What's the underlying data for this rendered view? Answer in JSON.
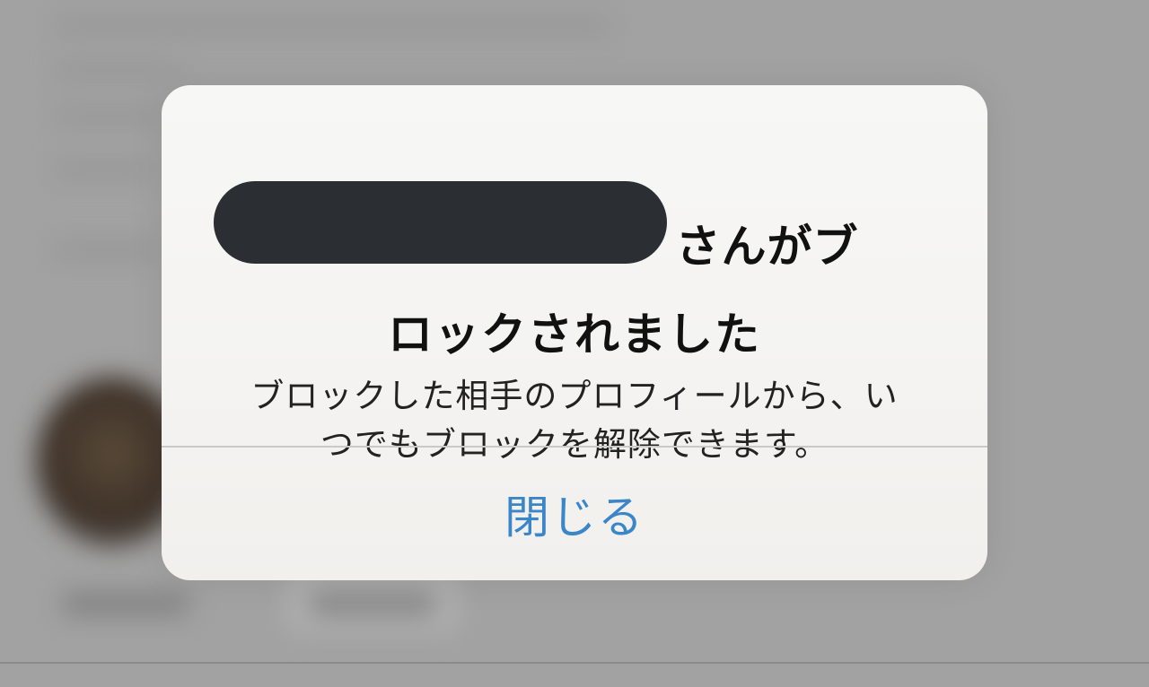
{
  "alert": {
    "title_line1_suffix": "さんがブ",
    "title_line2": "ロックされました",
    "message_line1": "ブロックした相手のプロフィールから、い",
    "message_line2": "つでもブロックを解除できます。",
    "close_label": "閉じる"
  },
  "colors": {
    "button_text": "#3a86c9",
    "redaction": "#2b2f33"
  }
}
